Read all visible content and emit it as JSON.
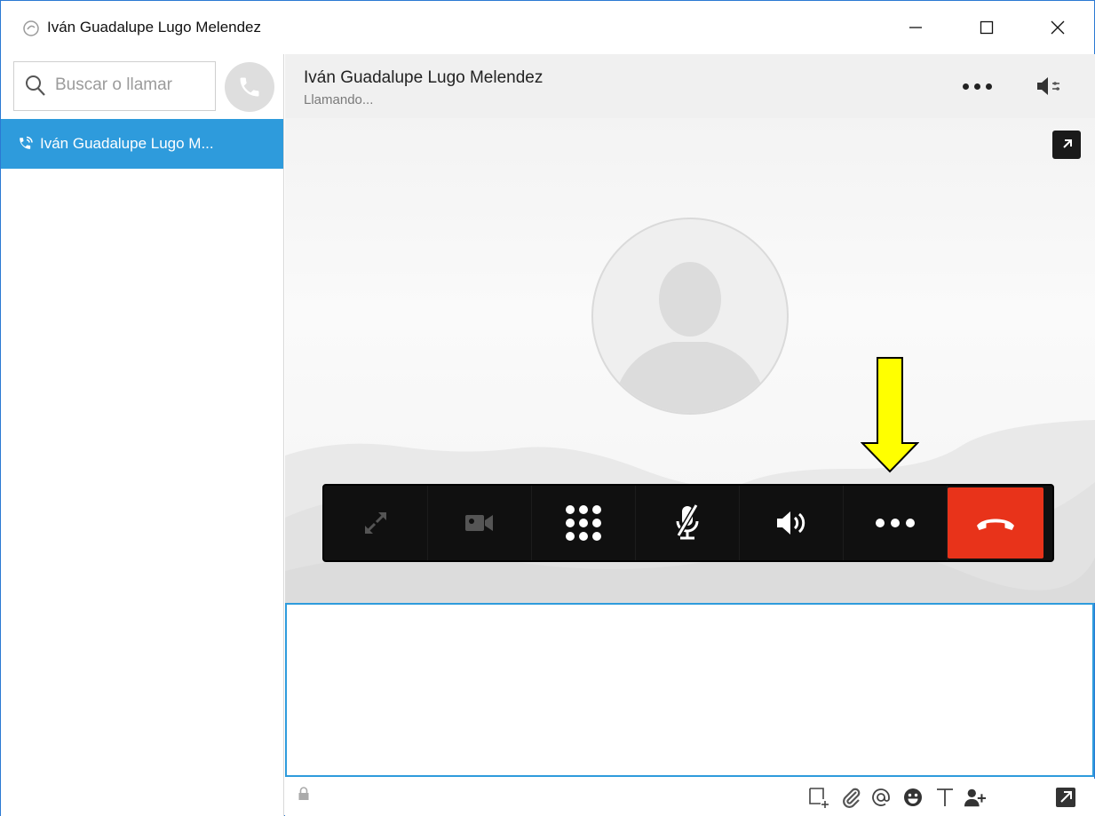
{
  "window": {
    "title": "Iván Guadalupe Lugo Melendez",
    "controls": {
      "minimize": "minimize-icon",
      "maximize": "maximize-icon",
      "close": "close-icon"
    }
  },
  "sidebar": {
    "search": {
      "placeholder": "Buscar o llamar",
      "icon": "search-icon"
    },
    "call_button_icon": "phone-icon",
    "items": [
      {
        "label": "Iván Guadalupe Lugo M...",
        "icon": "active-call-icon",
        "selected": true
      }
    ]
  },
  "header": {
    "name": "Iván Guadalupe Lugo Melendez",
    "status": "Llamando...",
    "more_icon": "more-icon",
    "volume_icon": "speaker-settings-icon"
  },
  "call": {
    "expand_icon": "popout-icon",
    "avatar_icon": "default-avatar-icon",
    "controls": [
      {
        "name": "fullscreen",
        "icon": "fullscreen-icon",
        "enabled": false
      },
      {
        "name": "video",
        "icon": "video-camera-icon",
        "enabled": false
      },
      {
        "name": "dialpad",
        "icon": "dialpad-icon",
        "enabled": true
      },
      {
        "name": "mute",
        "icon": "microphone-muted-icon",
        "enabled": true
      },
      {
        "name": "volume",
        "icon": "volume-icon",
        "enabled": true
      },
      {
        "name": "more",
        "icon": "more-icon",
        "enabled": true
      },
      {
        "name": "end-call",
        "icon": "hang-up-icon",
        "enabled": true
      }
    ],
    "annotation": {
      "type": "arrow",
      "color": "#ffff00",
      "points_to": "more"
    }
  },
  "message": {
    "value": ""
  },
  "toolbar": {
    "icons": [
      "lock-icon",
      "screen-snip-icon",
      "attachment-icon",
      "mention-icon",
      "emoticon-icon",
      "text-format-icon",
      "add-contact-icon",
      "popout-icon"
    ]
  },
  "colors": {
    "accent": "#2e9bdc",
    "end_call": "#e8331a",
    "control_bar": "#101010",
    "header_bg": "#f0f0f0",
    "window_border": "#2b79d3"
  }
}
